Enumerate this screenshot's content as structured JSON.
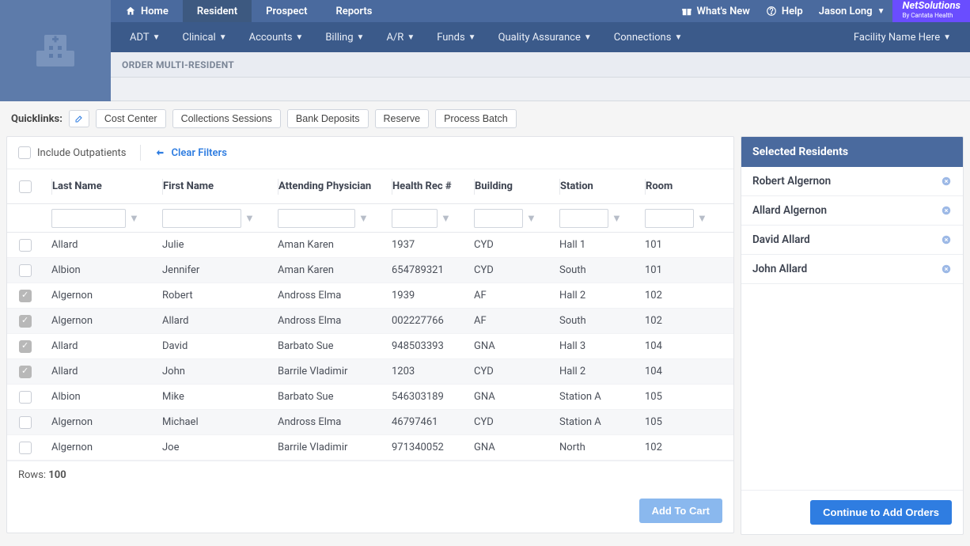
{
  "top": {
    "tabs": [
      {
        "label": "Home",
        "icon": "home"
      },
      {
        "label": "Resident",
        "active": true
      },
      {
        "label": "Prospect"
      },
      {
        "label": "Reports"
      }
    ],
    "right": {
      "whatsnew": "What's New",
      "help": "Help",
      "user": "Jason Long"
    },
    "brand": {
      "line1": "NetSolutions",
      "line2": "By Cantata Health"
    }
  },
  "menu": {
    "items": [
      "ADT",
      "Clinical",
      "Accounts",
      "Billing",
      "A/R",
      "Funds",
      "Quality Assurance",
      "Connections"
    ],
    "facility": "Facility Name Here"
  },
  "page_title": "ORDER MULTI-RESIDENT",
  "quicklinks": {
    "label": "Quicklinks:",
    "items": [
      "Cost Center",
      "Collections Sessions",
      "Bank Deposits",
      "Reserve",
      "Process Batch"
    ]
  },
  "filters": {
    "include_outpatients": "Include Outpatients",
    "clear": "Clear Filters"
  },
  "table": {
    "headers": [
      "Last Name",
      "First Name",
      "Attending Physician",
      "Health Rec #",
      "Building",
      "Station",
      "Room"
    ],
    "rows": [
      {
        "checked": false,
        "last": "Allard",
        "first": "Julie",
        "phys": "Aman Karen",
        "hrec": "1937",
        "bldg": "CYD",
        "station": "Hall 1",
        "room": "101"
      },
      {
        "checked": false,
        "last": "Albion",
        "first": "Jennifer",
        "phys": "Aman Karen",
        "hrec": "654789321",
        "bldg": "CYD",
        "station": "South",
        "room": "101"
      },
      {
        "checked": true,
        "last": "Algernon",
        "first": "Robert",
        "phys": "Andross Elma",
        "hrec": "1939",
        "bldg": "AF",
        "station": "Hall 2",
        "room": "102"
      },
      {
        "checked": true,
        "last": "Algernon",
        "first": "Allard",
        "phys": "Andross Elma",
        "hrec": "002227766",
        "bldg": "AF",
        "station": "South",
        "room": "102"
      },
      {
        "checked": true,
        "last": "Allard",
        "first": "David",
        "phys": "Barbato Sue",
        "hrec": "948503393",
        "bldg": "GNA",
        "station": "Hall 3",
        "room": "104"
      },
      {
        "checked": true,
        "last": "Allard",
        "first": "John",
        "phys": "Barrile Vladimir",
        "hrec": "1203",
        "bldg": "CYD",
        "station": "Hall 2",
        "room": "104"
      },
      {
        "checked": false,
        "last": "Albion",
        "first": "Mike",
        "phys": "Barbato Sue",
        "hrec": "546303189",
        "bldg": "GNA",
        "station": "Station A",
        "room": "105"
      },
      {
        "checked": false,
        "last": "Algernon",
        "first": "Michael",
        "phys": "Andross Elma",
        "hrec": "46797461",
        "bldg": "CYD",
        "station": "Station A",
        "room": "105"
      },
      {
        "checked": false,
        "last": "Algernon",
        "first": "Joe",
        "phys": "Barrile Vladimir",
        "hrec": "971340052",
        "bldg": "GNA",
        "station": "North",
        "room": "102"
      }
    ],
    "rows_label": "Rows:",
    "rows_count": "100"
  },
  "actions": {
    "add_to_cart": "Add To Cart",
    "continue": "Continue to Add Orders"
  },
  "selected": {
    "title": "Selected Residents",
    "items": [
      "Robert Algernon",
      "Allard Algernon",
      "David Allard",
      "John Allard"
    ]
  }
}
